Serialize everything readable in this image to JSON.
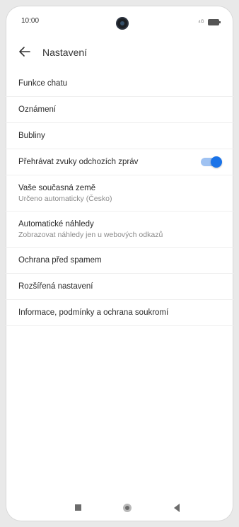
{
  "status_bar": {
    "time": "10:00",
    "signal": "⁴ᴳ",
    "icons": [
      "camera-cutout",
      "signal-icon",
      "battery-icon"
    ]
  },
  "app_bar": {
    "title": "Nastavení",
    "back_icon": "arrow-left-icon"
  },
  "settings": {
    "items": [
      {
        "label": "Funkce chatu"
      },
      {
        "label": "Oznámení"
      },
      {
        "label": "Bubliny"
      },
      {
        "label": "Přehrávat zvuky odchozích zpráv",
        "toggle_on": true
      },
      {
        "label": "Vaše současná země",
        "sub": "Určeno automaticky (Česko)"
      },
      {
        "label": "Automatické náhledy",
        "sub": "Zobrazovat náhledy jen u webových odkazů"
      },
      {
        "label": "Ochrana před spamem"
      },
      {
        "label": "Rozšířená nastavení"
      },
      {
        "label": "Informace, podmínky a ochrana soukromí"
      }
    ]
  },
  "colors": {
    "accent": "#1a73e8",
    "toggle_track": "#9fc2f2"
  },
  "navigation_bar": {
    "icons": [
      "recent-apps-icon",
      "home-icon",
      "back-triangle-icon"
    ]
  }
}
